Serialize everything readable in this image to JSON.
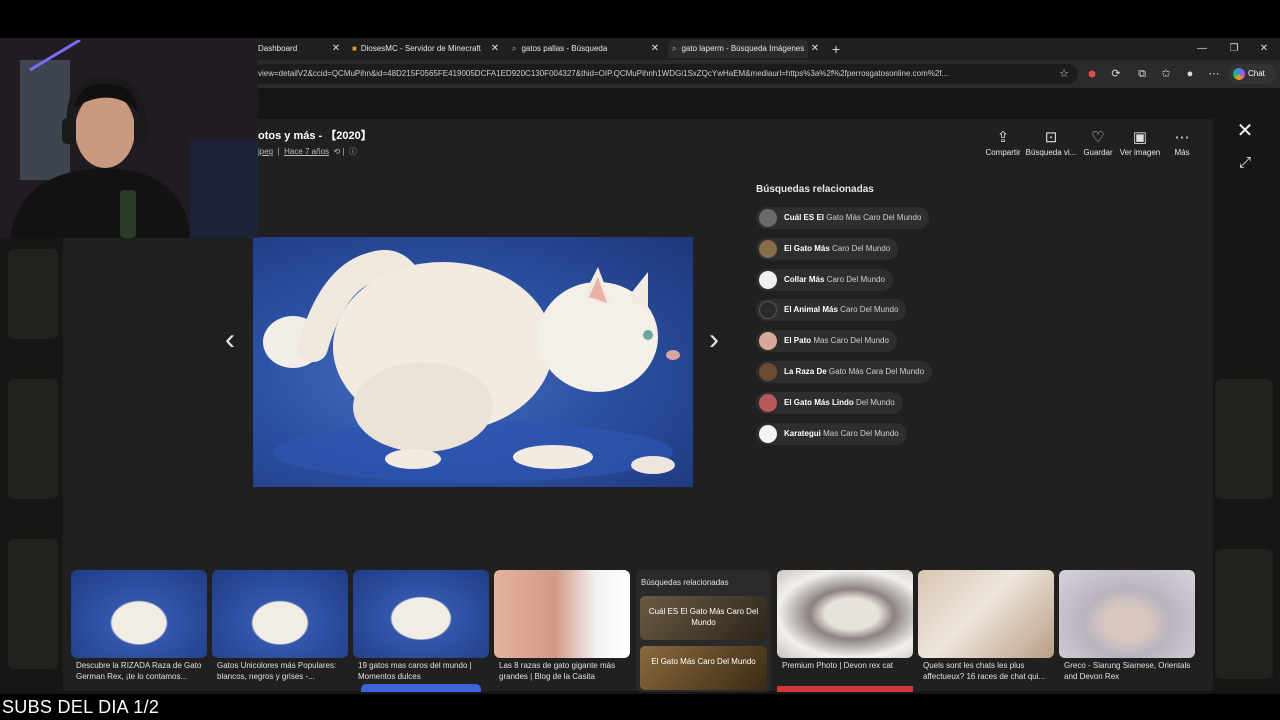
{
  "tabs": [
    {
      "label": "Dashboard",
      "active": false
    },
    {
      "label": "DiosesMC - Servidor de Minecraft",
      "active": false
    },
    {
      "label": "gatos pallas - Búsqueda",
      "active": false
    },
    {
      "label": "gato laperm - Búsqueda Imágenes",
      "active": true
    }
  ],
  "new_tab_glyph": "+",
  "url": "view=detailV2&ccid=QCMuPihn&id=48D215F0565FE419005DCFA1ED920C130F004327&thid=OIP.QCMuPihnh1WDGi1SxZQcYwHaEM&mediaurl=https%3a%2f%2fperrosgatosonline.com%2f...",
  "chat_label": "Chat",
  "viewer": {
    "title": "otos y más - 【2020】",
    "meta_ext": "jpeg",
    "meta_time": "Hace 7 años",
    "actions": [
      {
        "label": "Compartir",
        "icon": "share-icon"
      },
      {
        "label": "Búsqueda vi...",
        "icon": "visual-search-icon"
      },
      {
        "label": "Guardar",
        "icon": "save-icon"
      },
      {
        "label": "Ver imagen",
        "icon": "view-image-icon"
      },
      {
        "label": "Más",
        "icon": "more-icon"
      }
    ]
  },
  "related": {
    "title": "Búsquedas relacionadas",
    "items": [
      {
        "bold": "Cuál ES El",
        "rest": " Gato Más Caro Del Mundo"
      },
      {
        "bold": "El Gato Más",
        "rest": " Caro Del Mundo"
      },
      {
        "bold": "Collar Más",
        "rest": " Caro Del Mundo"
      },
      {
        "bold": "El Animal Más",
        "rest": " Caro Del Mundo"
      },
      {
        "bold": "El Pato",
        "rest": " Mas Caro Del Mundo"
      },
      {
        "bold": "La Raza De",
        "rest": " Gato Más Cara Del Mundo"
      },
      {
        "bold": "El Gato Más Lindo",
        "rest": " Del Mundo"
      },
      {
        "bold": "Karategui",
        "rest": " Mas Caro Del Mundo"
      }
    ]
  },
  "thumbs": [
    {
      "caption": "Descubre la RIZADA Raza de Gato German Rex, ¡te lo contamos..."
    },
    {
      "caption": "Gatos Unicolores más Populares: blancos, negros y grises -..."
    },
    {
      "caption": "19 gatos mas caros del mundo | Momentos dulces"
    },
    {
      "caption": "Las 8 razas de gato gigante más grandes | Blog de la Casita"
    },
    {
      "caption": "Premium Photo | Devon rex cat"
    },
    {
      "caption": "Quels sont les chats les plus affectueux? 16 races de chat qui..."
    },
    {
      "caption": "Greco - Siarung Siamese, Orientals and Devon Rex"
    }
  ],
  "rel_card": {
    "title": "Búsquedas relacionadas",
    "items": [
      "Cuál ES El Gato Más Caro Del Mundo",
      "El Gato Más Caro Del Mundo"
    ]
  },
  "overlay_text": "SUBS DEL DIA 1/2",
  "colors": {
    "modal_bg": "#202020",
    "pill_bg": "#2e2e2e",
    "page_bg": "#161616"
  }
}
